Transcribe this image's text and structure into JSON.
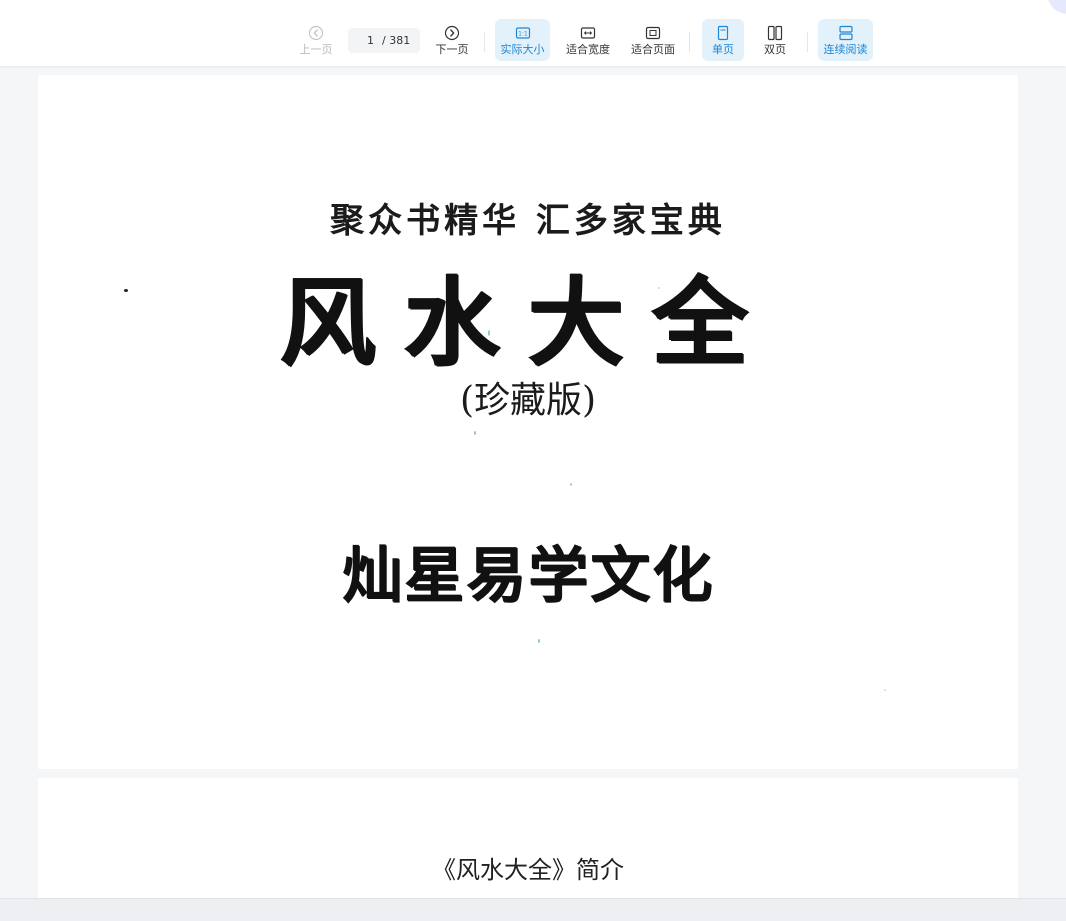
{
  "toolbar": {
    "prev_label": "上一页",
    "next_label": "下一页",
    "current_page": "1",
    "total_pages": "/ 381",
    "actual_size_label": "实际大小",
    "fit_width_label": "适合宽度",
    "fit_page_label": "适合页面",
    "single_page_label": "单页",
    "double_page_label": "双页",
    "continuous_label": "连续阅读",
    "active_zoom_mode": "actual_size",
    "active_page_mode": "single",
    "continuous_enabled": true,
    "accent_color": "#1f86d4",
    "active_bg_color": "#e3f1fb"
  },
  "document": {
    "pages": [
      {
        "tagline": "聚众书精华  汇多家宝典",
        "title": "风水大全",
        "edition": "(珍藏版)",
        "publisher": "灿星易学文化"
      },
      {
        "heading": "《风水大全》简介"
      }
    ]
  },
  "icons": {
    "prev": "chevron-left-circle-icon",
    "next": "chevron-right-circle-icon",
    "actual_size": "one-to-one-icon",
    "fit_width": "horizontal-arrows-icon",
    "fit_page": "fit-page-icon",
    "single_page": "single-page-icon",
    "double_page": "double-page-icon",
    "continuous": "stacked-pages-icon"
  }
}
